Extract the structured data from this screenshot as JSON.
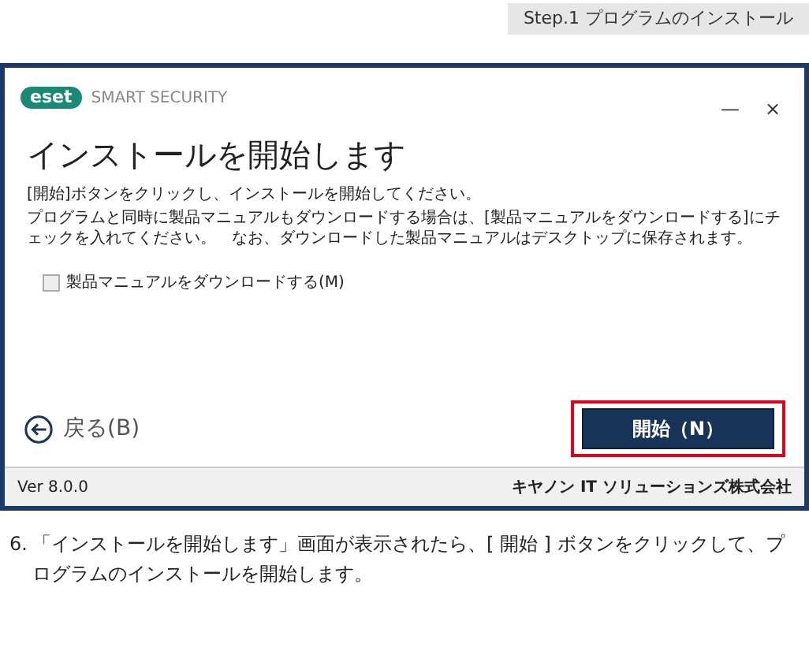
{
  "step_label": "Step.1 プログラムのインストール",
  "window": {
    "logo": "eset",
    "product": "SMART SECURITY",
    "controls": [
      "—",
      "×"
    ],
    "title": "インストールを開始します",
    "paragraphs": [
      "[開始]ボタンをクリックし、インストールを開始してください。",
      "プログラムと同時に製品マニュアルもダウンロードする場合は、[製品マニュアルをダウンロードする]にチェックを入れてください。　なお、ダウンロードした製品マニュアルはデスクトップに保存されます。"
    ],
    "checkbox": {
      "label": "製品マニュアルをダウンロードする(M)",
      "checked": false
    },
    "back_button": "戻る(B)",
    "start_button": {
      "label": "開始（N）",
      "highlighted": true
    },
    "status_bar": {
      "version": "Ver 8.0.0",
      "company": "キヤノン IT ソリューションズ株式会社"
    }
  },
  "caption": {
    "number": "6.",
    "text": "「インストールを開始します」画面が表示されたら、[ 開始 ] ボタンをクリックして、プログラムのインストールを開始します。"
  }
}
